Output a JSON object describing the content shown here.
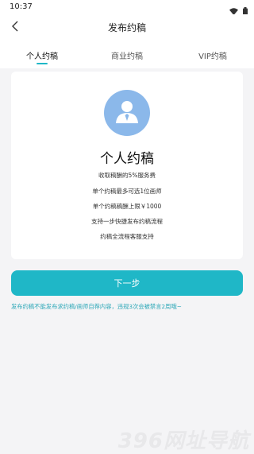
{
  "status_bar": {
    "time": "10:37",
    "icons": [
      "wifi-icon",
      "battery-icon"
    ]
  },
  "header": {
    "title": "发布约稿",
    "back_icon": "chevron-left-icon"
  },
  "tabs": [
    {
      "label": "个人约稿",
      "active": true
    },
    {
      "label": "商业约稿",
      "active": false
    },
    {
      "label": "VIP约稿",
      "active": false
    }
  ],
  "card": {
    "avatar_icon": "person-avatar-icon",
    "title": "个人约稿",
    "features": [
      "收取稿酬的5%服务费",
      "单个约稿最多可选1位画师",
      "单个约稿稿酬上限￥1000",
      "支持一步快捷发布约稿流程",
      "约稿全流程客服支持"
    ]
  },
  "primary_button": {
    "label": "下一步"
  },
  "notice": "发布约稿不能发布求约稿/画师自荐内容，违规3次会被禁言2周哦~",
  "watermark": "396网址导航",
  "colors": {
    "accent": "#1fb7c7",
    "avatar_bg": "#8bb8ea",
    "background": "#f4f4f6"
  }
}
